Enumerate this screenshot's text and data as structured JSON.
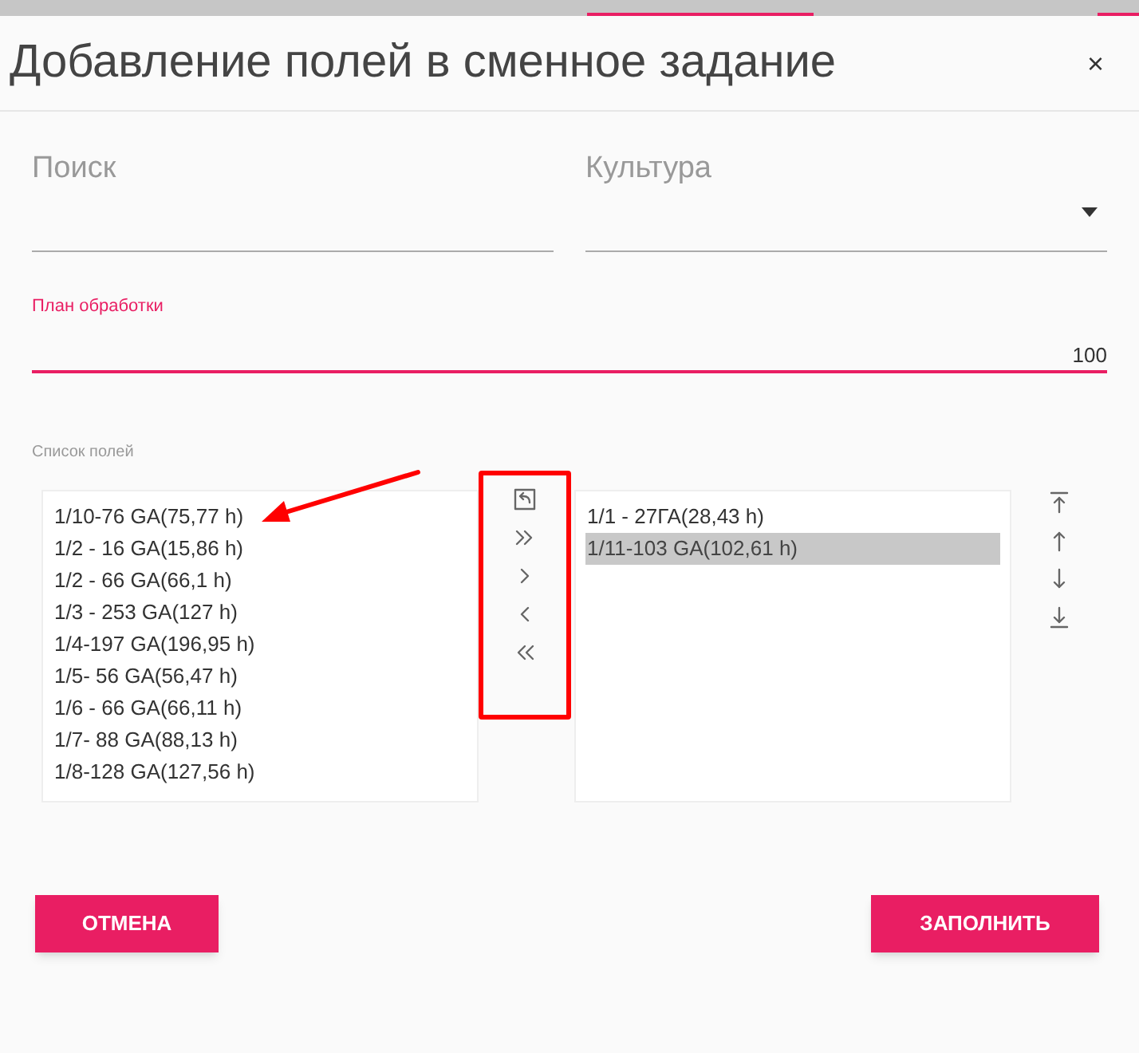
{
  "title": "Добавление полей в сменное задание",
  "close": "×",
  "search": {
    "placeholder": "Поиск"
  },
  "culture": {
    "placeholder": "Культура"
  },
  "plan": {
    "label": "План обработки",
    "value": "100",
    "focused": true
  },
  "fields_label": "Список полей",
  "available": [
    {
      "label": "1/10-76 GA(75,77 h)",
      "selected": false
    },
    {
      "label": "1/2 - 16 GA(15,86 h)",
      "selected": false
    },
    {
      "label": "1/2 - 66 GA(66,1 h)",
      "selected": false
    },
    {
      "label": "1/3 - 253 GA(127 h)",
      "selected": false
    },
    {
      "label": "1/4-197 GA(196,95 h)",
      "selected": false
    },
    {
      "label": "1/5- 56 GA(56,47 h)",
      "selected": false
    },
    {
      "label": "1/6 - 66 GA(66,11 h)",
      "selected": false
    },
    {
      "label": "1/7- 88 GA(88,13 h)",
      "selected": false
    },
    {
      "label": "1/8-128 GA(127,56 h)",
      "selected": false
    }
  ],
  "transfer_buttons": [
    {
      "kind": "reset"
    },
    {
      "kind": "all_right"
    },
    {
      "kind": "right"
    },
    {
      "kind": "left"
    },
    {
      "kind": "all_left"
    }
  ],
  "chosen": [
    {
      "label": "1/1 - 27ГА(28,43 h)",
      "selected": false
    },
    {
      "label": "1/11-103 GA(102,61 h)",
      "selected": true
    }
  ],
  "order_buttons": [
    {
      "kind": "top"
    },
    {
      "kind": "up"
    },
    {
      "kind": "down"
    },
    {
      "kind": "bottom"
    }
  ],
  "cancel": "ОТМЕНА",
  "fill": "ЗАПОЛНИТЬ"
}
